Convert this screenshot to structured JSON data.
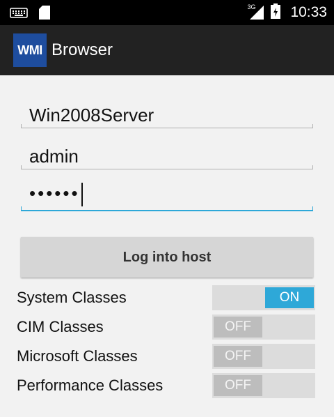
{
  "status_bar": {
    "network_type": "3G",
    "time": "10:33",
    "icons": [
      "keyboard-icon",
      "sd-card-icon",
      "signal-icon",
      "battery-icon"
    ]
  },
  "app_bar": {
    "logo_text": "WMI",
    "title": "Browser",
    "logo_color": "#1e4d9e"
  },
  "form": {
    "host": "Win2008Server",
    "username": "admin",
    "password_masked": "••••••",
    "accent_color": "#2ea8d8"
  },
  "login_button": {
    "label": "Log into host"
  },
  "toggles": [
    {
      "label": "System Classes",
      "state": "ON",
      "checked": true
    },
    {
      "label": "CIM Classes",
      "state": "OFF",
      "checked": false
    },
    {
      "label": "Microsoft Classes",
      "state": "OFF",
      "checked": false
    },
    {
      "label": "Performance Classes",
      "state": "OFF",
      "checked": false
    }
  ]
}
